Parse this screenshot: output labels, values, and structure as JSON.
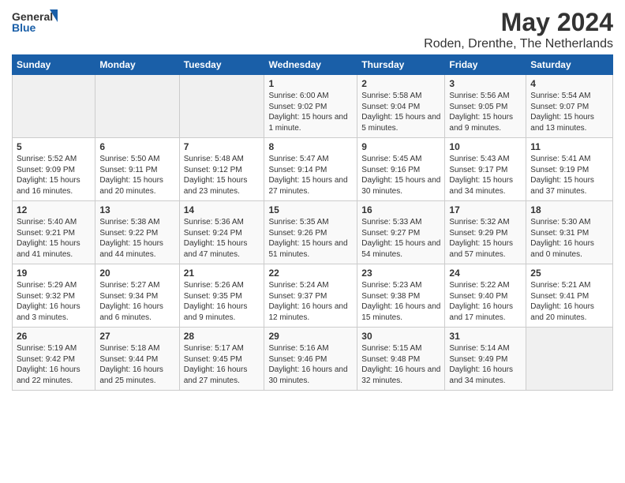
{
  "logo": {
    "text_general": "General",
    "text_blue": "Blue"
  },
  "title": "May 2024",
  "subtitle": "Roden, Drenthe, The Netherlands",
  "headers": [
    "Sunday",
    "Monday",
    "Tuesday",
    "Wednesday",
    "Thursday",
    "Friday",
    "Saturday"
  ],
  "weeks": [
    [
      {
        "day": "",
        "empty": true
      },
      {
        "day": "",
        "empty": true
      },
      {
        "day": "",
        "empty": true
      },
      {
        "day": "1",
        "sunrise": "6:00 AM",
        "sunset": "9:02 PM",
        "daylight": "15 hours and 1 minute."
      },
      {
        "day": "2",
        "sunrise": "5:58 AM",
        "sunset": "9:04 PM",
        "daylight": "15 hours and 5 minutes."
      },
      {
        "day": "3",
        "sunrise": "5:56 AM",
        "sunset": "9:05 PM",
        "daylight": "15 hours and 9 minutes."
      },
      {
        "day": "4",
        "sunrise": "5:54 AM",
        "sunset": "9:07 PM",
        "daylight": "15 hours and 13 minutes."
      }
    ],
    [
      {
        "day": "5",
        "sunrise": "5:52 AM",
        "sunset": "9:09 PM",
        "daylight": "15 hours and 16 minutes."
      },
      {
        "day": "6",
        "sunrise": "5:50 AM",
        "sunset": "9:11 PM",
        "daylight": "15 hours and 20 minutes."
      },
      {
        "day": "7",
        "sunrise": "5:48 AM",
        "sunset": "9:12 PM",
        "daylight": "15 hours and 23 minutes."
      },
      {
        "day": "8",
        "sunrise": "5:47 AM",
        "sunset": "9:14 PM",
        "daylight": "15 hours and 27 minutes."
      },
      {
        "day": "9",
        "sunrise": "5:45 AM",
        "sunset": "9:16 PM",
        "daylight": "15 hours and 30 minutes."
      },
      {
        "day": "10",
        "sunrise": "5:43 AM",
        "sunset": "9:17 PM",
        "daylight": "15 hours and 34 minutes."
      },
      {
        "day": "11",
        "sunrise": "5:41 AM",
        "sunset": "9:19 PM",
        "daylight": "15 hours and 37 minutes."
      }
    ],
    [
      {
        "day": "12",
        "sunrise": "5:40 AM",
        "sunset": "9:21 PM",
        "daylight": "15 hours and 41 minutes."
      },
      {
        "day": "13",
        "sunrise": "5:38 AM",
        "sunset": "9:22 PM",
        "daylight": "15 hours and 44 minutes."
      },
      {
        "day": "14",
        "sunrise": "5:36 AM",
        "sunset": "9:24 PM",
        "daylight": "15 hours and 47 minutes."
      },
      {
        "day": "15",
        "sunrise": "5:35 AM",
        "sunset": "9:26 PM",
        "daylight": "15 hours and 51 minutes."
      },
      {
        "day": "16",
        "sunrise": "5:33 AM",
        "sunset": "9:27 PM",
        "daylight": "15 hours and 54 minutes."
      },
      {
        "day": "17",
        "sunrise": "5:32 AM",
        "sunset": "9:29 PM",
        "daylight": "15 hours and 57 minutes."
      },
      {
        "day": "18",
        "sunrise": "5:30 AM",
        "sunset": "9:31 PM",
        "daylight": "16 hours and 0 minutes."
      }
    ],
    [
      {
        "day": "19",
        "sunrise": "5:29 AM",
        "sunset": "9:32 PM",
        "daylight": "16 hours and 3 minutes."
      },
      {
        "day": "20",
        "sunrise": "5:27 AM",
        "sunset": "9:34 PM",
        "daylight": "16 hours and 6 minutes."
      },
      {
        "day": "21",
        "sunrise": "5:26 AM",
        "sunset": "9:35 PM",
        "daylight": "16 hours and 9 minutes."
      },
      {
        "day": "22",
        "sunrise": "5:24 AM",
        "sunset": "9:37 PM",
        "daylight": "16 hours and 12 minutes."
      },
      {
        "day": "23",
        "sunrise": "5:23 AM",
        "sunset": "9:38 PM",
        "daylight": "16 hours and 15 minutes."
      },
      {
        "day": "24",
        "sunrise": "5:22 AM",
        "sunset": "9:40 PM",
        "daylight": "16 hours and 17 minutes."
      },
      {
        "day": "25",
        "sunrise": "5:21 AM",
        "sunset": "9:41 PM",
        "daylight": "16 hours and 20 minutes."
      }
    ],
    [
      {
        "day": "26",
        "sunrise": "5:19 AM",
        "sunset": "9:42 PM",
        "daylight": "16 hours and 22 minutes."
      },
      {
        "day": "27",
        "sunrise": "5:18 AM",
        "sunset": "9:44 PM",
        "daylight": "16 hours and 25 minutes."
      },
      {
        "day": "28",
        "sunrise": "5:17 AM",
        "sunset": "9:45 PM",
        "daylight": "16 hours and 27 minutes."
      },
      {
        "day": "29",
        "sunrise": "5:16 AM",
        "sunset": "9:46 PM",
        "daylight": "16 hours and 30 minutes."
      },
      {
        "day": "30",
        "sunrise": "5:15 AM",
        "sunset": "9:48 PM",
        "daylight": "16 hours and 32 minutes."
      },
      {
        "day": "31",
        "sunrise": "5:14 AM",
        "sunset": "9:49 PM",
        "daylight": "16 hours and 34 minutes."
      },
      {
        "day": "",
        "empty": true
      }
    ]
  ]
}
